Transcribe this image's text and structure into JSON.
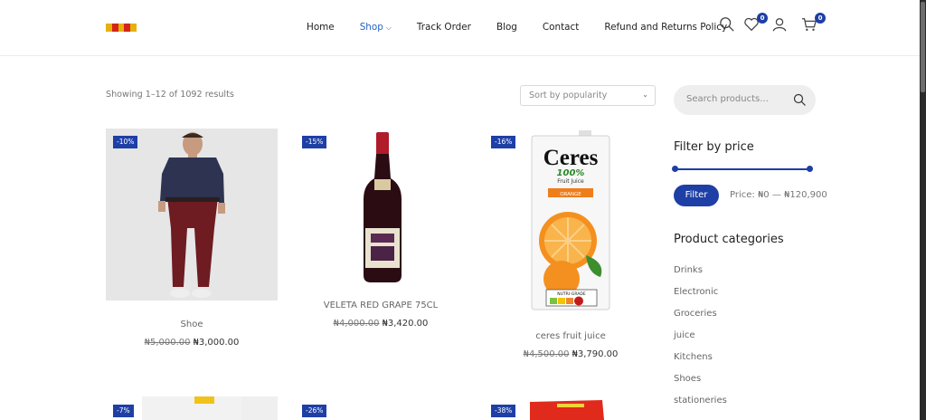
{
  "header": {
    "brand_colors": [
      "#e5b10f",
      "#d4241c",
      "#e5b10f",
      "#d4241c",
      "#e5b10f"
    ],
    "nav": [
      {
        "label": "Home"
      },
      {
        "label": "Shop",
        "active": true
      },
      {
        "label": "Track Order"
      },
      {
        "label": "Blog"
      },
      {
        "label": "Contact"
      },
      {
        "label": "Refund and Returns Policy"
      }
    ],
    "wishlist_count": "0",
    "cart_count": "0"
  },
  "toolbar": {
    "results_text": "Showing 1–12 of 1092 results",
    "sort_value": "Sort by popularity"
  },
  "products": [
    {
      "name": "Shoe",
      "sale": "-10%",
      "old_price": "₦5,000.00",
      "price": "₦3,000.00"
    },
    {
      "name": "VELETA RED GRAPE 75CL",
      "sale": "-15%",
      "old_price": "₦4,000.00",
      "price": "₦3,420.00"
    },
    {
      "name": "ceres fruit juice",
      "sale": "-16%",
      "old_price": "₦4,500.00",
      "price": "₦3,790.00",
      "image_text": {
        "brand": "Ceres",
        "line1": "100%",
        "line2": "Fruit Juice",
        "flavor": "ORANGE",
        "grade": "NUTRI-GRADE"
      }
    },
    {
      "sale": "-7%"
    },
    {
      "sale": "-26%"
    },
    {
      "sale": "-38%"
    }
  ],
  "sidebar": {
    "search_placeholder": "Search products...",
    "filter_title": "Filter by price",
    "filter_button": "Filter",
    "price_label": "Price: ₦0 — ₦120,900",
    "categories_title": "Product categories",
    "categories": [
      "Drinks",
      "Electronic",
      "Groceries",
      "juice",
      "Kitchens",
      "Shoes",
      "stationeries"
    ]
  },
  "colors": {
    "accent": "#1e3fa6",
    "nav_active": "#2563c7"
  }
}
